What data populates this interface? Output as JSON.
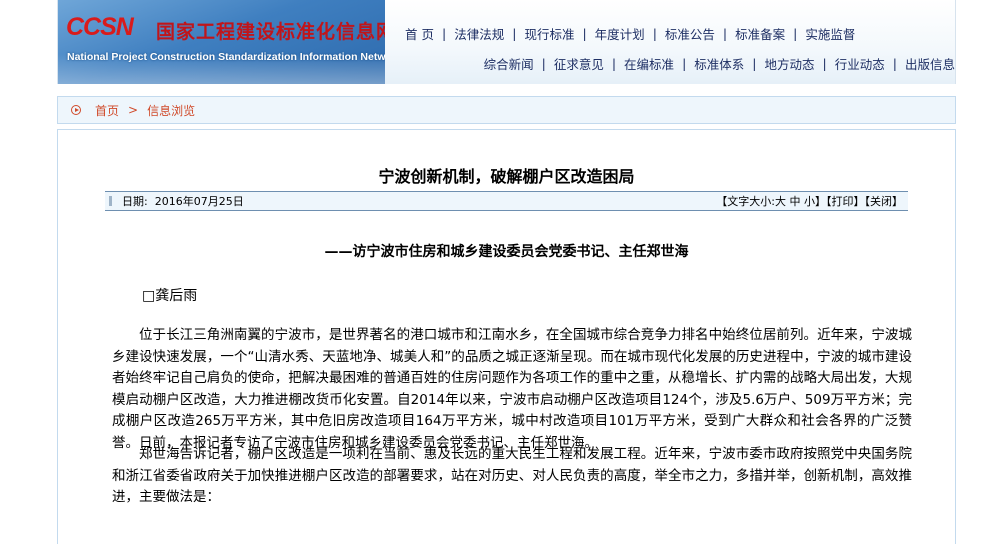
{
  "site": {
    "logo_mark": "CCSN",
    "name_cn": "国家工程建设标准化信息网",
    "name_en": "National Project Construction Standardization Information Network"
  },
  "nav": {
    "row1": [
      "首 页",
      "法律法规",
      "现行标准",
      "年度计划",
      "标准公告",
      "标准备案",
      "实施监督"
    ],
    "row2": [
      "综合新闻",
      "征求意见",
      "在编标准",
      "标准体系",
      "地方动态",
      "行业动态",
      "出版信息"
    ]
  },
  "breadcrumb": {
    "home": "首页",
    "separator": ">",
    "current": "信息浏览"
  },
  "article": {
    "title": "宁波创新机制，破解棚户区改造困局",
    "date_label": "日期:",
    "date": "2016年07月25日",
    "font_size_label": "【文字大小:",
    "font_large": "大",
    "font_medium": "中",
    "font_small": "小",
    "font_close_bracket": "】",
    "print": "【打印】",
    "close": "【关闭】",
    "subtitle": "——访宁波市住房和城乡建设委员会党委书记、主任郑世海",
    "author": "□龚后雨",
    "paragraphs": [
      "位于长江三角洲南翼的宁波市，是世界著名的港口城市和江南水乡，在全国城市综合竞争力排名中始终位居前列。近年来，宁波城乡建设快速发展，一个“山清水秀、天蓝地净、城美人和”的品质之城正逐渐呈现。而在城市现代化发展的历史进程中，宁波的城市建设者始终牢记自己肩负的使命，把解决最困难的普通百姓的住房问题作为各项工作的重中之重，从稳增长、扩内需的战略大局出发，大规模启动棚户区改造，大力推进棚改货币化安置。自2014年以来，宁波市启动棚户区改造项目124个，涉及5.6万户、509万平方米；完成棚户区改造265万平方米，其中危旧房改造项目164万平方米，城中村改造项目101万平方米，受到广大群众和社会各界的广泛赞誉。日前，本报记者专访了宁波市住房和城乡建设委员会党委书记、主任郑世海。",
      "郑世海告诉记者，棚户区改造是一项利在当前、惠及长远的重大民生工程和发展工程。近年来，宁波市委市政府按照党中央国务院和浙江省委省政府关于加快推进棚户区改造的部署要求，站在对历史、对人民负责的高度，举全市之力，多措并举，创新机制，高效推进，主要做法是："
    ]
  },
  "colors": {
    "nav_text": "#1e2f64",
    "breadcrumb_text": "#d04a2a",
    "logo_red": "#c0151b",
    "panel_border": "#c3daee",
    "meta_bar_bg": "#eef6fc"
  }
}
